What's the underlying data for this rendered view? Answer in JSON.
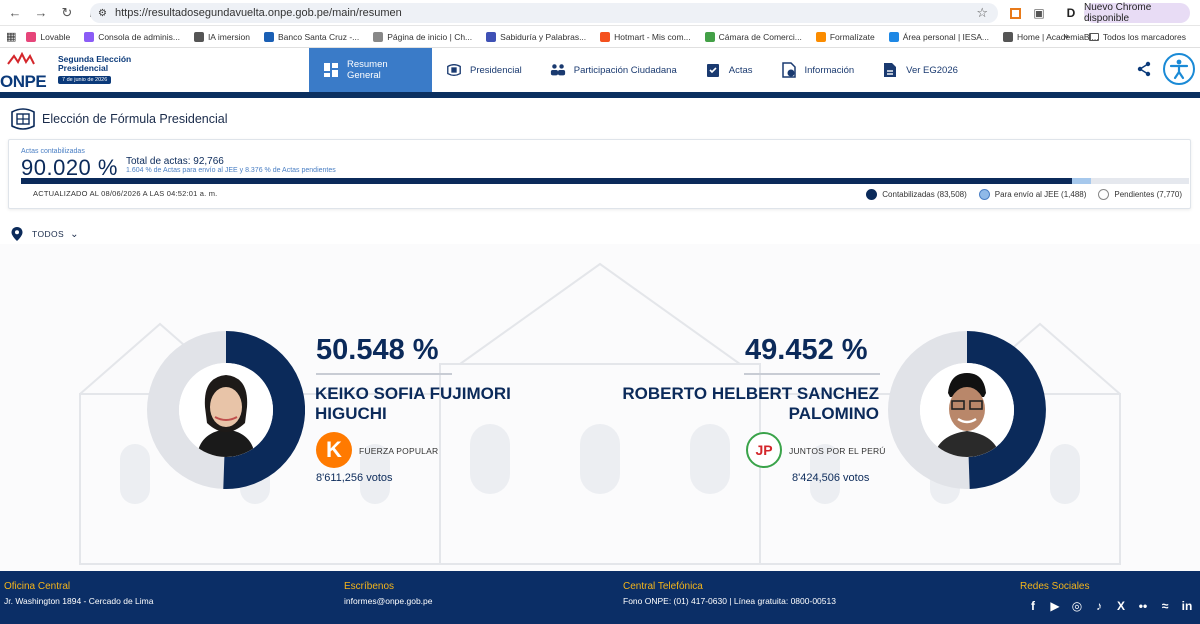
{
  "browser": {
    "url": "https://resultadosegundavuelta.onpe.gob.pe/main/resumen",
    "update_label": "Nuevo Chrome disponible",
    "bookmarks": [
      {
        "label": "Lovable",
        "color": "#e6457a"
      },
      {
        "label": "Consola de adminis...",
        "color": "#8b5cf6"
      },
      {
        "label": "IA imersion",
        "color": "#555555"
      },
      {
        "label": "Banco Santa Cruz -...",
        "color": "#1a5fb4"
      },
      {
        "label": "Página de inicio | Ch...",
        "color": "#888888"
      },
      {
        "label": "Sabiduría y Palabras...",
        "color": "#3f51b5"
      },
      {
        "label": "Hotmart - Mis com...",
        "color": "#f4511e"
      },
      {
        "label": "Cámara de Comerci...",
        "color": "#43a047"
      },
      {
        "label": "Formalízate",
        "color": "#fb8c00"
      },
      {
        "label": "Área personal | IESA...",
        "color": "#1e88e5"
      },
      {
        "label": "Home | AcademiaBl...",
        "color": "#555555"
      }
    ],
    "all_bookmarks_label": "Todos los marcadores"
  },
  "header": {
    "logo_text": "ONPE",
    "event_title_1": "Segunda Elección",
    "event_title_2": "Presidencial",
    "event_date": "7 de junio de 2026",
    "menu": [
      {
        "label": "Resumen General",
        "icon": "grid-icon",
        "active": true
      },
      {
        "label": "Presidencial",
        "icon": "emblem-icon",
        "active": false
      },
      {
        "label": "Participación Ciudadana",
        "icon": "people-icon",
        "active": false
      },
      {
        "label": "Actas",
        "icon": "clipboard-icon",
        "active": false
      },
      {
        "label": "Información",
        "icon": "info-doc-icon",
        "active": false
      },
      {
        "label": "Ver EG2026",
        "icon": "document-icon",
        "active": false
      }
    ]
  },
  "section": {
    "title": "Elección de Fórmula Presidencial"
  },
  "summary": {
    "label": "Actas contabilizadas",
    "percent": "90.020 %",
    "total": "Total de actas: 92,766",
    "sub": "1.604 % de Actas para envío al JEE y 8.376 % de Actas pendientes",
    "updated": "ACTUALIZADO AL 08/06/2026 A LAS 04:52:01 a. m.",
    "progress": {
      "counted": 90.02,
      "jee": 1.604,
      "pending": 8.376
    },
    "legend": [
      {
        "label": "Contabilizadas (83,508)",
        "color": "#0b2a5a",
        "border": "#0b2a5a"
      },
      {
        "label": "Para envío al JEE (1,488)",
        "color": "#8fb9e8",
        "border": "#4a7fc4"
      },
      {
        "label": "Pendientes (7,770)",
        "color": "#ffffff",
        "border": "#888888"
      }
    ]
  },
  "filter": {
    "label": "TODOS"
  },
  "candidates": [
    {
      "percent": "50.548 %",
      "share": 50.548,
      "name_1": "KEIKO SOFIA FUJIMORI",
      "name_2": "HIGUCHI",
      "party": "FUERZA POPULAR",
      "party_logo_text": "K",
      "votes": "8'611,256 votos"
    },
    {
      "percent": "49.452 %",
      "share": 49.452,
      "name_1": "ROBERTO HELBERT SANCHEZ",
      "name_2": "PALOMINO",
      "party": "JUNTOS POR EL PERÚ",
      "party_logo_text": "JP",
      "votes": "8'424,506 votos"
    }
  ],
  "footer": {
    "office_title": "Oficina Central",
    "office_text": "Jr. Washington 1894 - Cercado de Lima",
    "write_title": "Escríbenos",
    "write_text": "informes@onpe.gob.pe",
    "phone_title": "Central Telefónica",
    "phone_text": "Fono ONPE: (01) 417-0630 | Línea gratuita: 0800-00513",
    "social_title": "Redes Sociales",
    "social": [
      "facebook-icon",
      "youtube-icon",
      "instagram-icon",
      "tiktok-icon",
      "x-icon",
      "flickr-icon",
      "spotify-icon",
      "linkedin-icon"
    ]
  },
  "colors": {
    "primary": "#0b2a5a",
    "accent": "#3a7bc8",
    "footer": "#0b2e66",
    "footer_title": "#f5b51a"
  }
}
